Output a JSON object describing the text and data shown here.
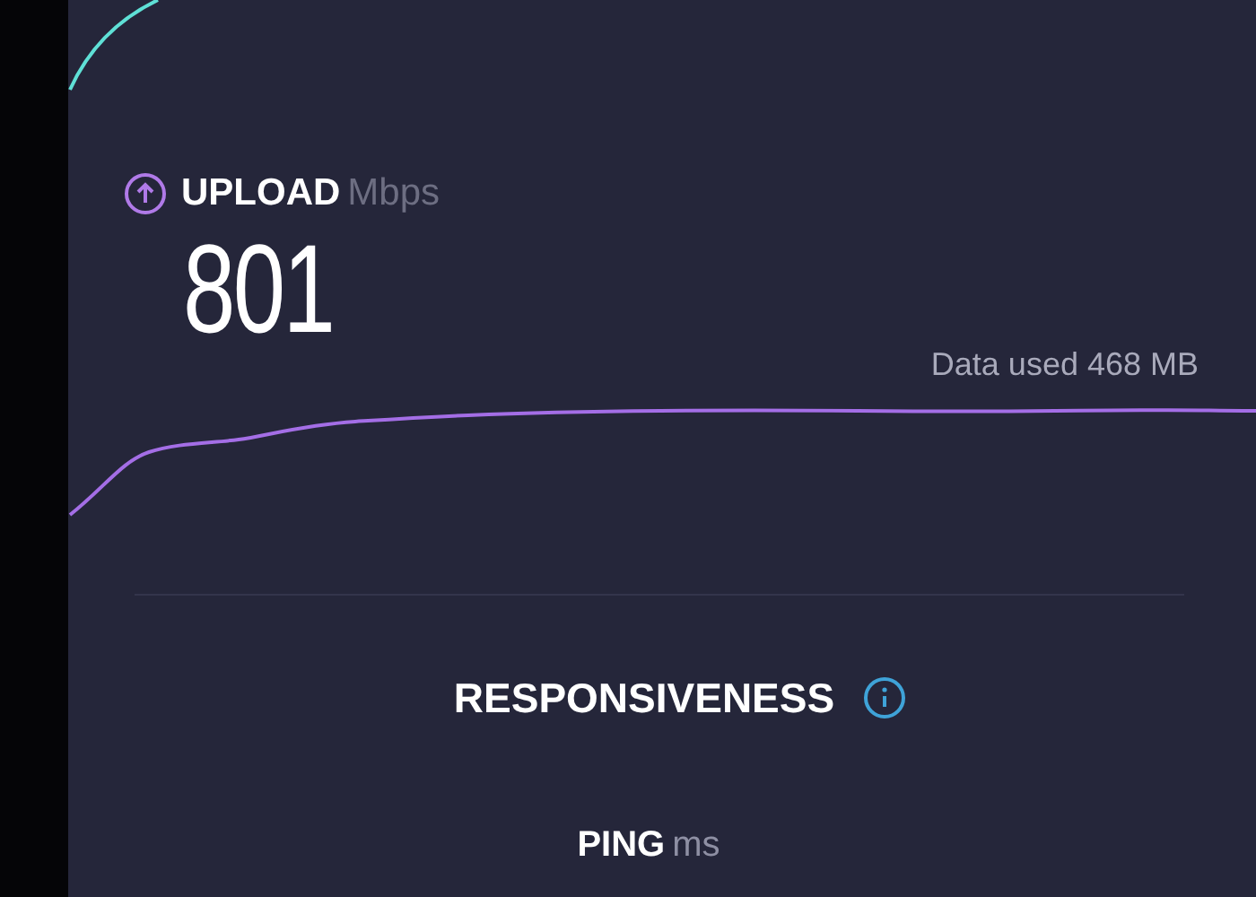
{
  "upload": {
    "label": "UPLOAD",
    "unit": "Mbps",
    "value": "801",
    "data_used": "Data used 468 MB"
  },
  "responsiveness": {
    "title": "RESPONSIVENESS"
  },
  "ping": {
    "label": "PING",
    "unit": "ms"
  }
}
